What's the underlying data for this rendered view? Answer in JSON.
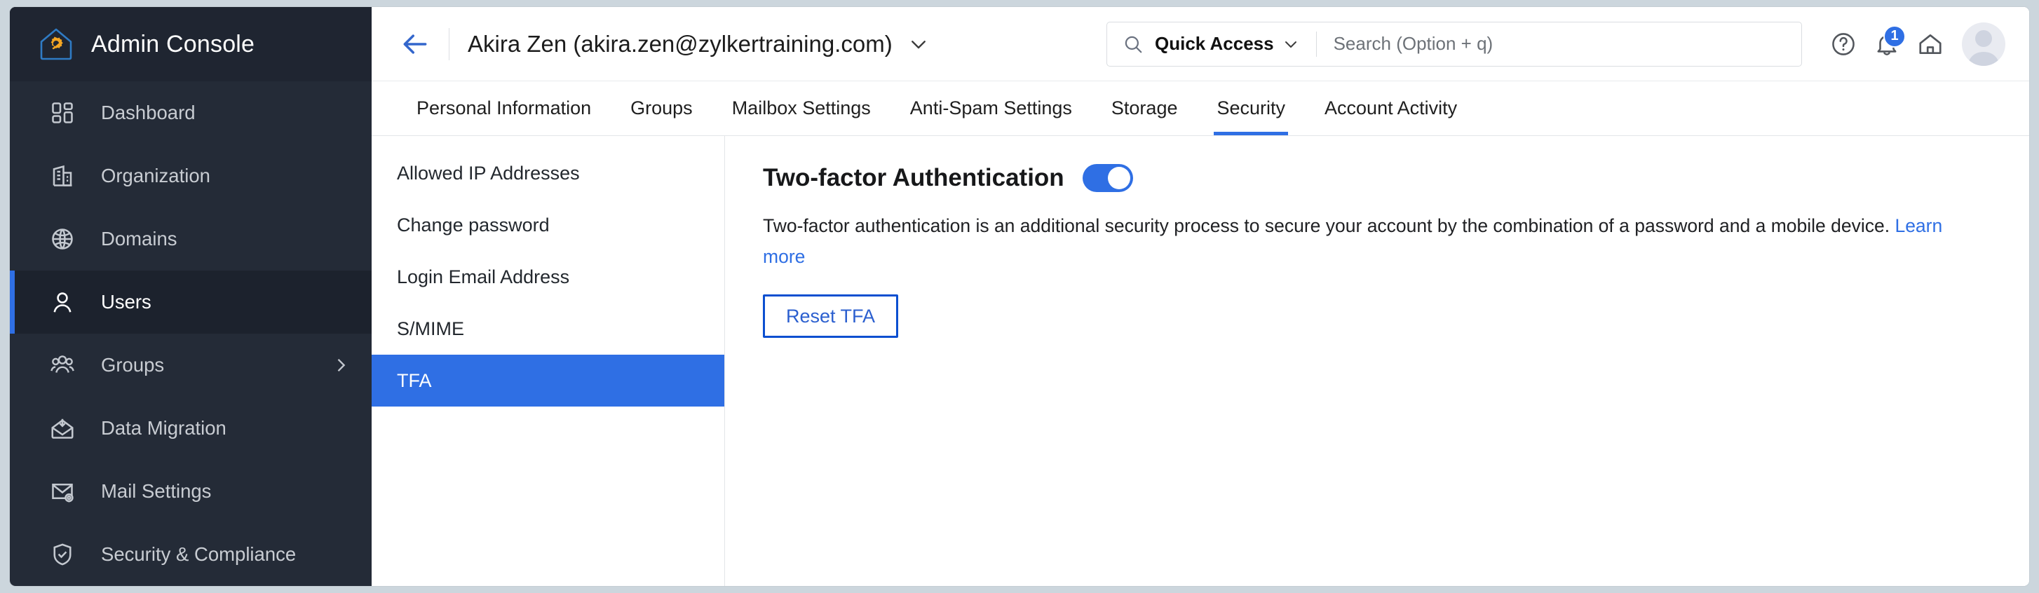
{
  "brand": {
    "title": "Admin Console",
    "logo_icon": "house-gear-icon",
    "logo_house_color": "#2f7bc4",
    "logo_gear_color": "#f5a623"
  },
  "colors": {
    "accent_blue": "#2f6fe4",
    "sidebar_bg": "#242b37",
    "sidebar_active_bg": "#1c222d",
    "page_bg": "#ccd6dd",
    "button_border": "#0b4fd0"
  },
  "sidebar": {
    "items": [
      {
        "label": "Dashboard",
        "icon": "dashboard-grid-icon",
        "active": false,
        "has_chevron": false
      },
      {
        "label": "Organization",
        "icon": "building-icon",
        "active": false,
        "has_chevron": false
      },
      {
        "label": "Domains",
        "icon": "globe-icon",
        "active": false,
        "has_chevron": false
      },
      {
        "label": "Users",
        "icon": "user-icon",
        "active": true,
        "has_chevron": false
      },
      {
        "label": "Groups",
        "icon": "users-group-icon",
        "active": false,
        "has_chevron": true
      },
      {
        "label": "Data Migration",
        "icon": "envelope-download-icon",
        "active": false,
        "has_chevron": false
      },
      {
        "label": "Mail Settings",
        "icon": "envelope-gear-icon",
        "active": false,
        "has_chevron": false
      },
      {
        "label": "Security & Compliance",
        "icon": "shield-check-icon",
        "active": false,
        "has_chevron": false
      }
    ]
  },
  "topbar": {
    "back_icon": "arrow-left-icon",
    "user_title": "Akira Zen (akira.zen@zylkertraining.com)",
    "user_caret_icon": "chevron-down-icon",
    "search": {
      "search_icon": "search-icon",
      "quick_access_label": "Quick Access",
      "quick_access_caret_icon": "chevron-down-icon",
      "placeholder": "Search (Option + q)",
      "value": ""
    },
    "help_icon": "help-circle-icon",
    "notification_icon": "bell-icon",
    "notification_count": "1",
    "home_icon": "home-icon",
    "avatar_icon": "avatar-icon"
  },
  "tabs": [
    {
      "label": "Personal Information",
      "active": false
    },
    {
      "label": "Groups",
      "active": false
    },
    {
      "label": "Mailbox Settings",
      "active": false
    },
    {
      "label": "Anti-Spam Settings",
      "active": false
    },
    {
      "label": "Storage",
      "active": false
    },
    {
      "label": "Security",
      "active": true
    },
    {
      "label": "Account Activity",
      "active": false
    }
  ],
  "subnav": [
    {
      "label": "Allowed IP Addresses",
      "active": false
    },
    {
      "label": "Change password",
      "active": false
    },
    {
      "label": "Login Email Address",
      "active": false
    },
    {
      "label": "S/MIME",
      "active": false
    },
    {
      "label": "TFA",
      "active": true
    }
  ],
  "content": {
    "title": "Two-factor Authentication",
    "toggle_on": true,
    "description": "Two-factor authentication is an additional security process to secure your account by the combination of a password and a mobile device. ",
    "learn_more_label": "Learn more",
    "reset_button_label": "Reset TFA"
  }
}
